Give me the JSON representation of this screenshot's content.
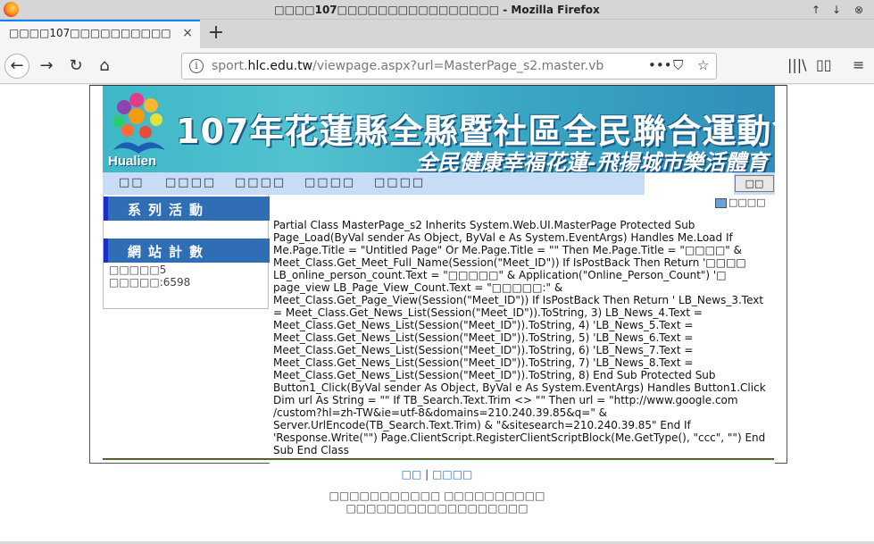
{
  "window": {
    "title": "□□□□107□□□□□□□□□□□□□□□□ - Mozilla Firefox"
  },
  "tab": {
    "title": "□□□□107□□□□□□□□□□□□□□□□□",
    "close": "×",
    "new_tab": "+"
  },
  "nav": {
    "back": "←",
    "forward": "→",
    "reload": "↻",
    "home": "⌂",
    "url_prefix": "sport.",
    "url_host": "hlc.edu.tw",
    "url_path": "/viewpage.aspx?url=MasterPage_s2.master.vb",
    "info": "i",
    "more": "•••",
    "pocket": "⛉",
    "bookmark": "☆",
    "library": "|||\\",
    "sidebar": "▯▯",
    "menu": "≡"
  },
  "banner": {
    "logo_text": "Hualien",
    "title": "107年花蓮縣全縣暨社區全民聯合運動會",
    "slogan": "全民健康幸福花蓮-飛揚城市樂活體育"
  },
  "menu": [
    "□□",
    "□□□□",
    "□□□□",
    "□□□□",
    "□□□□"
  ],
  "search_button": "□□",
  "print_label": "□□□□",
  "sidebar": {
    "activities_heading": "系列活動",
    "stats_heading": "網站計數",
    "online": "□□□□□5",
    "views": "□□□□□:6598"
  },
  "content": "Partial Class MasterPage_s2 Inherits System.Web.UI.MasterPage Protected Sub Page_Load(ByVal sender As Object, ByVal e As System.EventArgs) Handles Me.Load If Me.Page.Title = \"Untitled Page\" Or Me.Page.Title = \"\" Then Me.Page.Title = \"□□□□\" & Meet_Class.Get_Meet_Full_Name(Session(\"Meet_ID\")) If IsPostBack Then Return '□□□□ LB_online_person_count.Text = \"□□□□□\" & Application(\"Online_Person_Count\") '□ page_view LB_Page_View_Count.Text = \"□□□□□:\" & Meet_Class.Get_Page_View(Session(\"Meet_ID\")) If IsPostBack Then Return ' LB_News_3.Text = Meet_Class.Get_News_List(Session(\"Meet_ID\")).ToString, 3) LB_News_4.Text = Meet_Class.Get_News_List(Session(\"Meet_ID\")).ToString, 4) 'LB_News_5.Text = Meet_Class.Get_News_List(Session(\"Meet_ID\")).ToString, 5) 'LB_News_6.Text = Meet_Class.Get_News_List(Session(\"Meet_ID\")).ToString, 6) 'LB_News_7.Text = Meet_Class.Get_News_List(Session(\"Meet_ID\")).ToString, 7) 'LB_News_8.Text = Meet_Class.Get_News_List(Session(\"Meet_ID\")).ToString, 8) End Sub Protected Sub Button1_Click(ByVal sender As Object, ByVal e As System.EventArgs) Handles Button1.Click Dim url As String = \"\" If TB_Search.Text.Trim <> \"\" Then url = \"http://www.google.com /custom?hl=zh-TW&ie=utf-8&domains=210.240.39.85&q=\" & Server.UrlEncode(TB_Search.Text.Trim) & \"&sitesearch=210.240.39.85\" End If 'Response.Write(\"\") Page.ClientScript.RegisterClientScriptBlock(Me.GetType(), \"ccc\", \"\") End Sub End Class",
  "footer": {
    "link1": "□□",
    "separator": "|",
    "link2": "□□□□",
    "line1": "□□□□□□□□□□□ □□□□□□□□□□",
    "line2": "□□□□□□□□□□□□□□□□□□"
  }
}
